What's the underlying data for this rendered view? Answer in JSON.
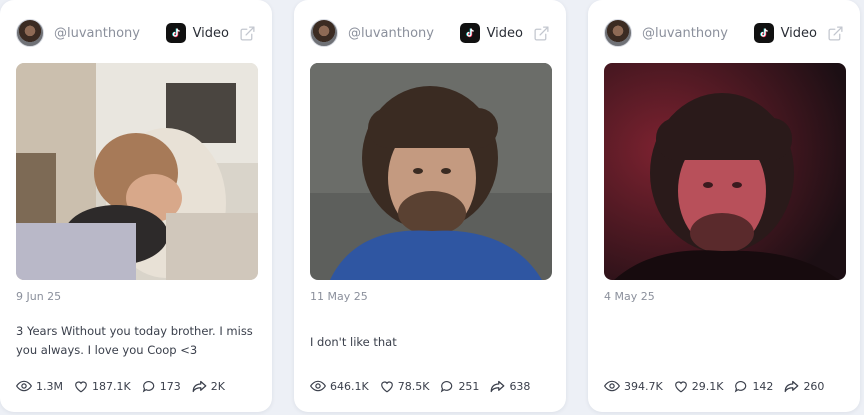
{
  "posts": [
    {
      "username": "@luvanthony",
      "platform": "Video",
      "date": "9 Jun 25",
      "caption": "3 Years Without you today brother. I miss you always. I love you Coop <3",
      "views": "1.3M",
      "likes": "187.1K",
      "comments": "173",
      "shares": "2K"
    },
    {
      "username": "@luvanthony",
      "platform": "Video",
      "date": "11 May 25",
      "caption": "I don't like that",
      "views": "646.1K",
      "likes": "78.5K",
      "comments": "251",
      "shares": "638"
    },
    {
      "username": "@luvanthony",
      "platform": "Video",
      "date": "4 May 25",
      "caption": "",
      "views": "394.7K",
      "likes": "29.1K",
      "comments": "142",
      "shares": "260"
    }
  ]
}
